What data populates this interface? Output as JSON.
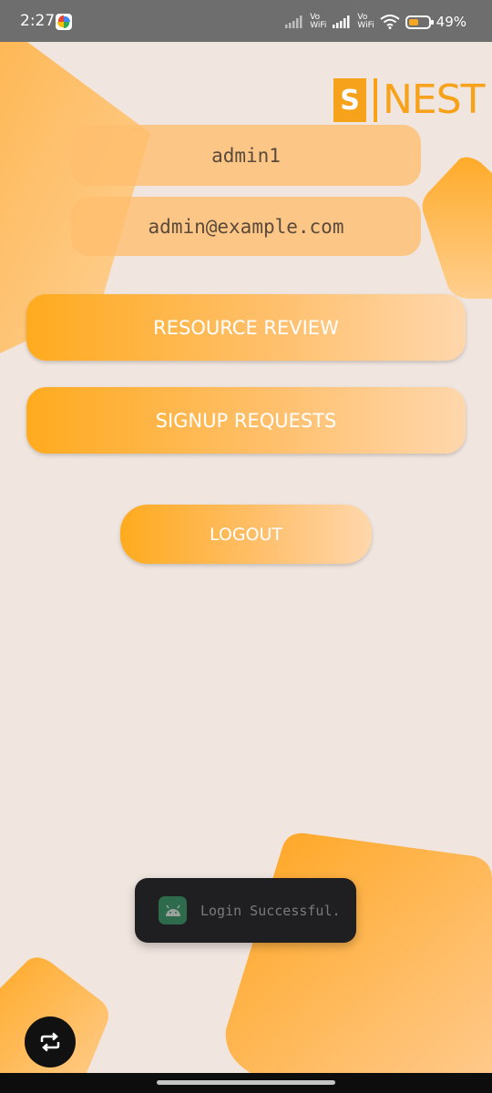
{
  "status_bar": {
    "time": "2:27",
    "network_label_1": "Vo",
    "network_label_2": "WiFi",
    "network_label_3": "Vo",
    "network_label_4": "WiFi",
    "battery_percent": "49%",
    "battery_level": 0.49
  },
  "logo": {
    "letter": "S",
    "text": "NEST"
  },
  "profile": {
    "username": "admin1",
    "email": "admin@example.com"
  },
  "actions": {
    "resource_review_label": "RESOURCE REVIEW",
    "signup_requests_label": "SIGNUP REQUESTS",
    "logout_label": "LOGOUT"
  },
  "toast": {
    "message": "Login Successful.",
    "icon": "android-icon"
  },
  "colors": {
    "accent": "#f7a21b",
    "background": "#f0e5df",
    "button_gradient_start": "#ffab1f",
    "button_gradient_end": "#ffd7ac"
  }
}
